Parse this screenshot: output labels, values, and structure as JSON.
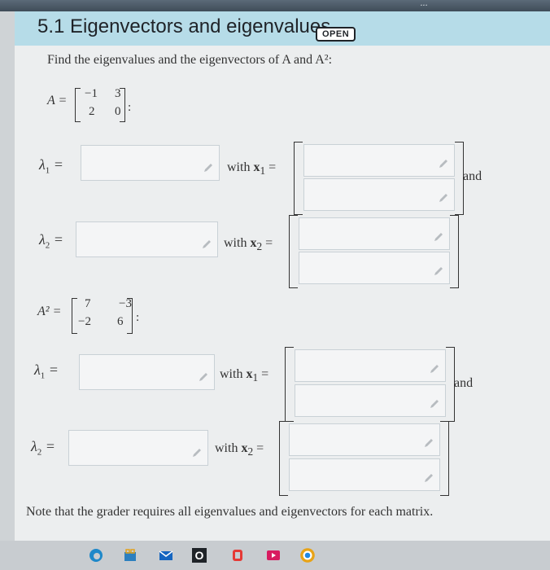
{
  "section": {
    "title": "5.1 Eigenvectors and eigenvalues",
    "badge": "OPEN"
  },
  "instructions": "Find the eigenvalues and the eigenvectors of A and A²:",
  "matrix_A": {
    "label": "A =",
    "cells": [
      "−1",
      "3",
      "2",
      "0"
    ],
    "suffix": ":"
  },
  "matrix_A2": {
    "label": "A² =",
    "cells": [
      "7",
      "−3",
      "−2",
      "6"
    ],
    "suffix": ":"
  },
  "rows": {
    "A_l1": {
      "lambda": "λ",
      "sub": "1",
      "eq": "=",
      "with": "with ",
      "x": "x",
      "xsub": "1",
      "xeq": "=",
      "trail": "and"
    },
    "A_l2": {
      "lambda": "λ",
      "sub": "2",
      "eq": "=",
      "with": "with ",
      "x": "x",
      "xsub": "2",
      "xeq": "="
    },
    "A2_l1": {
      "lambda": "λ",
      "sub": "1",
      "eq": "=",
      "with": "with ",
      "x": "x",
      "xsub": "1",
      "xeq": "=",
      "trail": "and"
    },
    "A2_l2": {
      "lambda": "λ",
      "sub": "2",
      "eq": "=",
      "with": "with ",
      "x": "x",
      "xsub": "2",
      "xeq": "="
    }
  },
  "note": "Note that the grader requires all eigenvalues and eigenvectors for each matrix.",
  "topbar_text": "...",
  "taskbar": {
    "icons": [
      "edge-icon",
      "store-icon",
      "mail-icon",
      "office-icon",
      "zoom-icon",
      "media-icon",
      "chrome-icon"
    ]
  },
  "colors": {
    "header_bg": "#b6dce8",
    "panel_bg": "#eceeef",
    "input_bg": "#f4f5f6"
  }
}
